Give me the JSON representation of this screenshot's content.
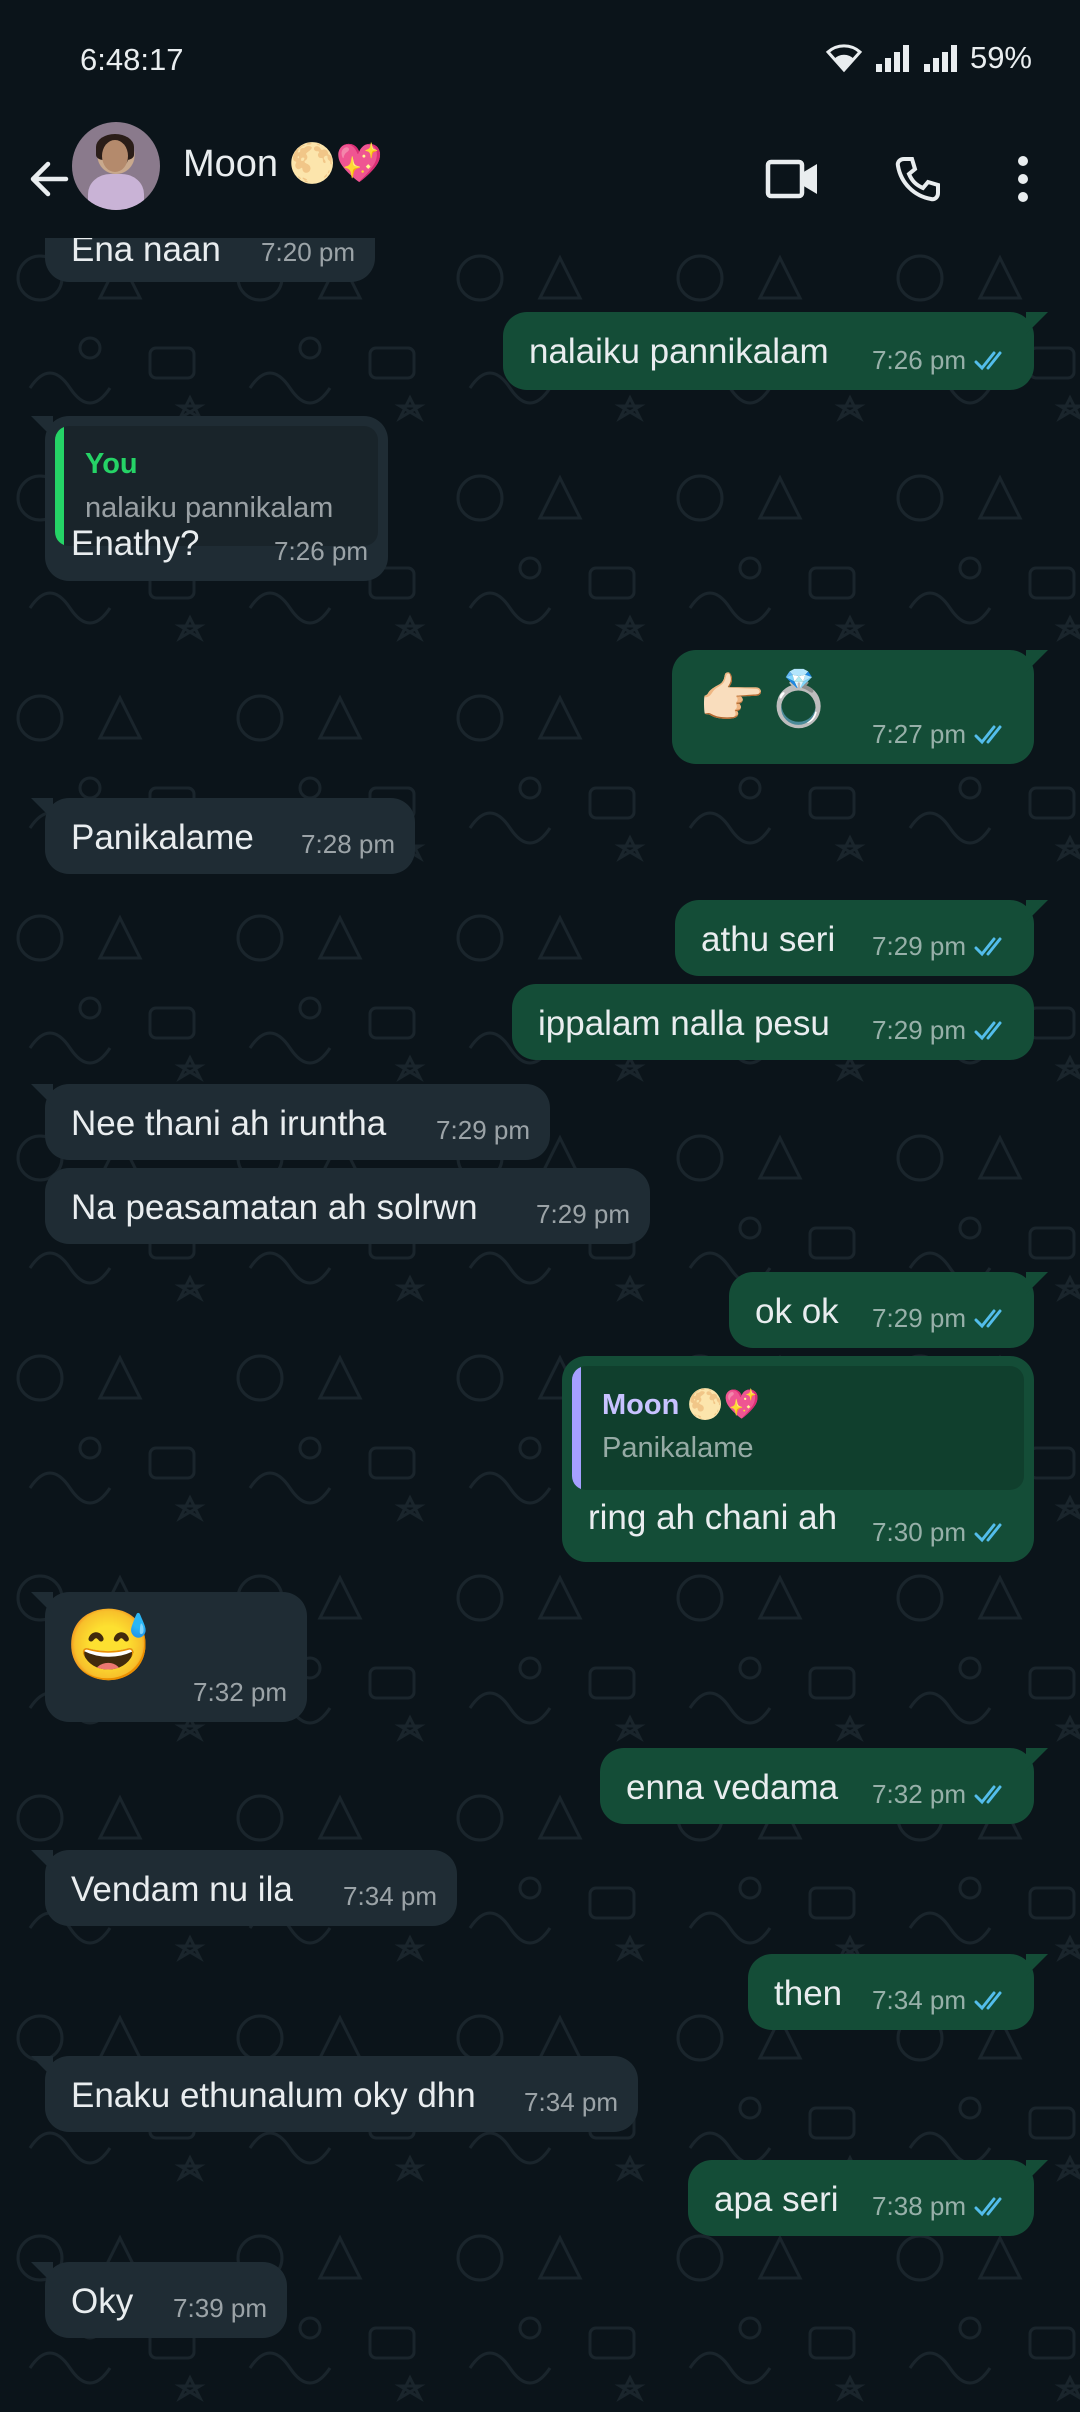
{
  "status_bar": {
    "time": "6:48:17",
    "battery": "59%"
  },
  "header": {
    "contact_name": "Moon 🌕💖",
    "icons": [
      "back-arrow-icon",
      "video-call-icon",
      "voice-call-icon",
      "more-options-icon"
    ]
  },
  "colors": {
    "background": "#0b141a",
    "incoming_bubble": "#1f2c34",
    "outgoing_bubble": "#144d37",
    "read_ticks": "#53bdeb",
    "quote_you": "#25d366",
    "quote_moon": "#a5a0ff"
  },
  "messages": [
    {
      "dir": "in",
      "text": "Ena naan",
      "time": "7:20 pm"
    },
    {
      "dir": "out",
      "text": "nalaiku pannikalam",
      "time": "7:26 pm"
    },
    {
      "dir": "in",
      "quote_name": "You",
      "quote_text": "nalaiku pannikalam",
      "text": "Enathy?",
      "time": "7:26 pm"
    },
    {
      "dir": "out",
      "text": "👉🏻💍",
      "time": "7:27 pm"
    },
    {
      "dir": "in",
      "text": "Panikalame",
      "time": "7:28 pm"
    },
    {
      "dir": "out",
      "text": "athu seri",
      "time": "7:29 pm"
    },
    {
      "dir": "out",
      "text": "ippalam nalla pesu",
      "time": "7:29 pm"
    },
    {
      "dir": "in",
      "text": "Nee thani ah iruntha",
      "time": "7:29 pm"
    },
    {
      "dir": "in",
      "text": "Na peasamatan ah solrwn",
      "time": "7:29 pm"
    },
    {
      "dir": "out",
      "text": "ok ok",
      "time": "7:29 pm"
    },
    {
      "dir": "out",
      "quote_name": "Moon 🌕💖",
      "quote_text": "Panikalame",
      "text": "ring ah chani ah",
      "time": "7:30 pm"
    },
    {
      "dir": "in",
      "text": "😅",
      "time": "7:32 pm"
    },
    {
      "dir": "out",
      "text": "enna vedama",
      "time": "7:32 pm"
    },
    {
      "dir": "in",
      "text": "Vendam nu ila",
      "time": "7:34 pm"
    },
    {
      "dir": "out",
      "text": "then",
      "time": "7:34 pm"
    },
    {
      "dir": "in",
      "text": "Enaku ethunalum oky dhn",
      "time": "7:34 pm"
    },
    {
      "dir": "out",
      "text": "apa seri",
      "time": "7:38 pm"
    },
    {
      "dir": "in",
      "text": "Oky",
      "time": "7:39 pm"
    }
  ]
}
